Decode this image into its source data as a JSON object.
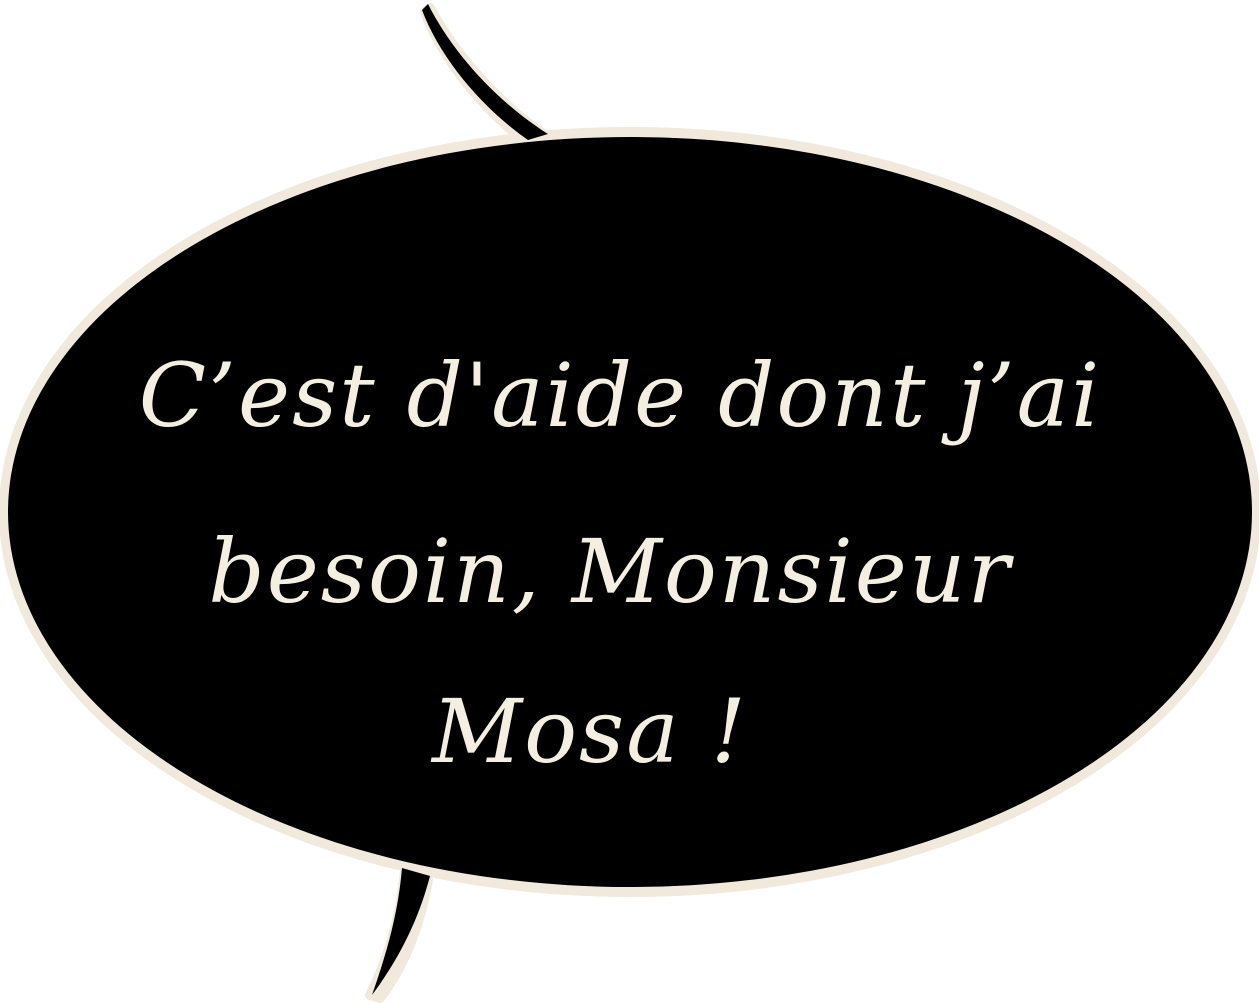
{
  "speech_bubble": {
    "fill_color": "#000000",
    "outline_color": "#f0e9dc",
    "text_color": "#f5efe2",
    "lines": [
      "C’est d'aide dont j’ai",
      "besoin, Monsieur",
      "Mosa !"
    ]
  }
}
